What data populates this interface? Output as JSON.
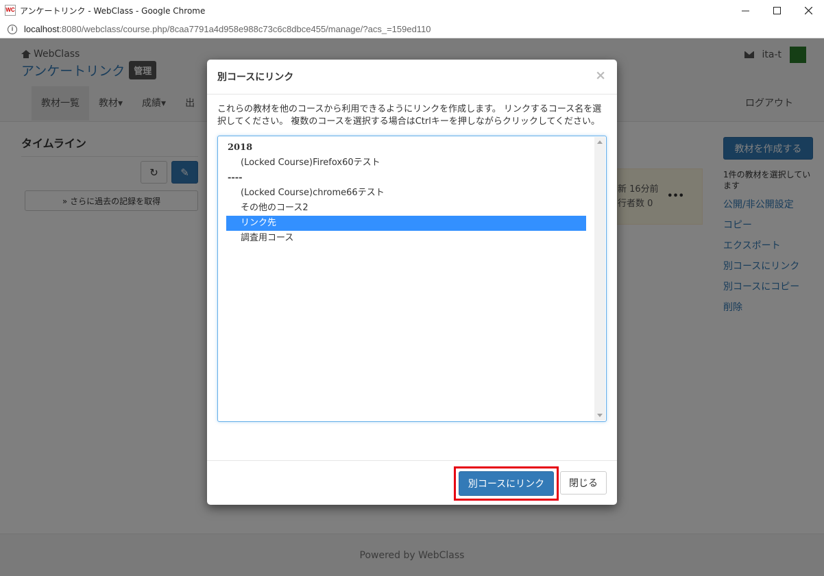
{
  "window": {
    "title": "アンケートリンク - WebClass - Google Chrome",
    "logo_text": "WC",
    "minimize_icon": "minimize-icon",
    "maximize_icon": "maximize-icon",
    "close_icon": "close-icon"
  },
  "address_bar": {
    "host": "localhost",
    "path": ":8080/webclass/course.php/8caa7791a4d958e988c73c6c8dbce455/manage/?acs_=159ed110"
  },
  "header": {
    "brand": "WebClass",
    "course_name": "アンケートリンク",
    "admin_badge": "管理",
    "user_name": "ita-t",
    "logout": "ログアウト",
    "nav": [
      "教材一覧",
      "教材▾",
      "成績▾",
      "出"
    ]
  },
  "timeline": {
    "title": "タイムライン",
    "refresh_icon": "↻",
    "edit_icon": "✎",
    "more_button": "» さらに過去の記録を取得"
  },
  "card": {
    "line1": "新 16分前",
    "line2": "行者数 0",
    "menu": "•••"
  },
  "sidebar": {
    "create_button": "教材を作成する",
    "selection_info": "1件の教材を選択しています",
    "actions": [
      "公開/非公開設定",
      "コピー",
      "エクスポート",
      "別コースにリンク",
      "別コースにコピー",
      "削除"
    ]
  },
  "footer": {
    "text": "Powered by WebClass"
  },
  "modal": {
    "title": "別コースにリンク",
    "close_symbol": "×",
    "description": "これらの教材を他のコースから利用できるようにリンクを作成します。 リンクするコース名を選択してください。 複数のコースを選択する場合はCtrlキーを押しながらクリックしてください。",
    "course_list": {
      "groups": [
        {
          "label": "2018",
          "options": [
            "(Locked Course)Firefox60テスト"
          ]
        },
        {
          "label": "----",
          "options": [
            "(Locked Course)chrome66テスト",
            "その他のコース2",
            "リンク先",
            "調査用コース"
          ]
        }
      ],
      "selected": "リンク先"
    },
    "link_button": "別コースにリンク",
    "close_button": "閉じる"
  }
}
